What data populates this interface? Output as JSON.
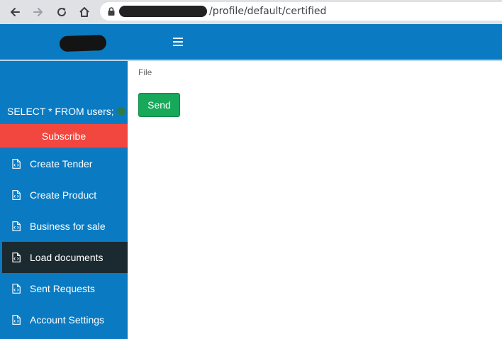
{
  "browser": {
    "url_path": "/profile/default/certified",
    "icons": [
      "back-arrow-icon",
      "forward-arrow-icon",
      "reload-icon",
      "home-icon",
      "lock-icon"
    ]
  },
  "header": {
    "menu_icon": "hamburger-icon",
    "color": "#0a7bc2"
  },
  "sidebar": {
    "sql_status": "SELECT * FROM users;",
    "subscribe_label": "Subscribe",
    "items": [
      {
        "label": "Create Tender",
        "icon": "document-icon"
      },
      {
        "label": "Create Product",
        "icon": "document-icon"
      },
      {
        "label": "Business for sale",
        "icon": "document-icon"
      },
      {
        "label": "Load documents",
        "icon": "document-icon",
        "active": true
      },
      {
        "label": "Sent Requests",
        "icon": "document-icon"
      },
      {
        "label": "Account Settings",
        "icon": "document-icon"
      }
    ],
    "colors": {
      "background": "#0a7bc2",
      "active": "#1b2a30",
      "subscribe": "#f2473f",
      "status_dot": "#2b7a4b"
    }
  },
  "main": {
    "file_label": "File",
    "send_label": "Send",
    "send_color": "#17a85a"
  }
}
